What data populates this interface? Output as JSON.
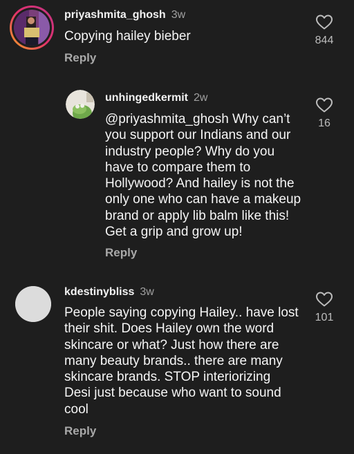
{
  "comments": [
    {
      "username": "priyashmita_ghosh",
      "time": "3w",
      "text": "Copying hailey bieber",
      "reply_label": "Reply",
      "likes": "844",
      "avatar_icon": "user-photo-avatar"
    },
    {
      "username": "unhingedkermit",
      "time": "2w",
      "text": "@priyashmita_ghosh Why can’t you support our Indians and our industry people? Why do you have to compare them to Hollywood? And hailey is not the only one who can have a makeup brand or apply lib balm like this! Get a grip and grow up!",
      "reply_label": "Reply",
      "likes": "16",
      "avatar_icon": "kermit-photo-avatar"
    },
    {
      "username": "kdestinybliss",
      "time": "3w",
      "text": "People saying copying Hailey.. have lost their shit. Does Hailey own the word skincare or what? Just how there are many beauty brands.. there are many skincare brands. STOP interiorizing Desi just because who want to sound cool",
      "reply_label": "Reply",
      "likes": "101",
      "avatar_icon": "default-avatar"
    }
  ],
  "colors": {
    "background": "#1e1e1e",
    "text": "#f5f5f5",
    "secondary": "#a0a0a0",
    "story_ring_start": "#f5a623",
    "story_ring_end": "#c13584"
  },
  "icons": {
    "like": "heart-outline-icon"
  }
}
